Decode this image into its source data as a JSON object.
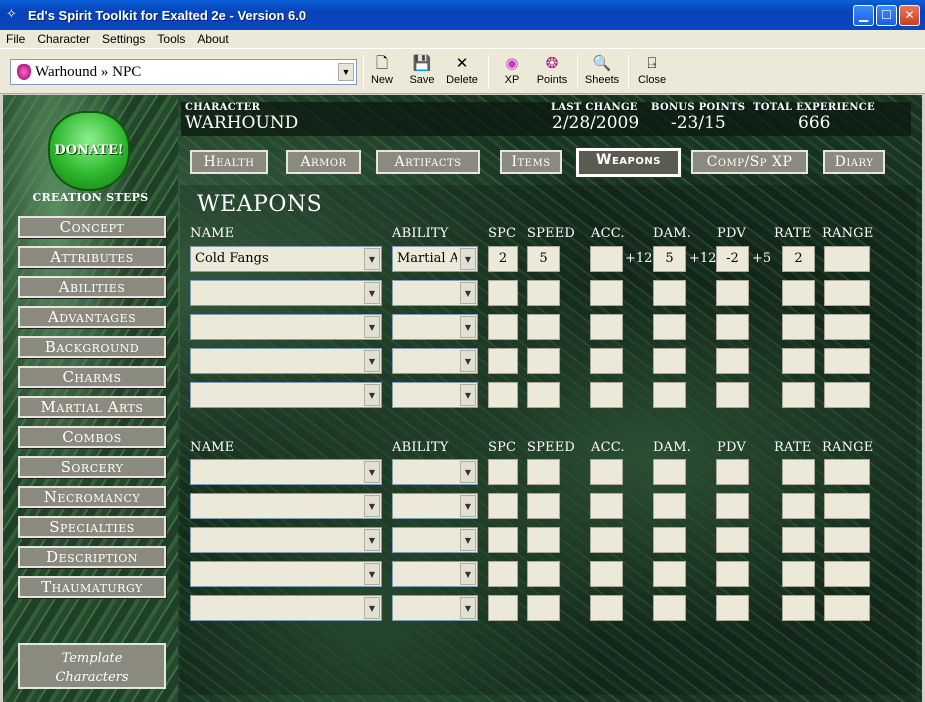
{
  "window": {
    "title": "Ed's Spirit Toolkit for Exalted 2e - Version 6.0"
  },
  "menu": [
    "File",
    "Character",
    "Settings",
    "Tools",
    "About"
  ],
  "toolbar": {
    "character_select": "Warhound » NPC",
    "buttons": [
      {
        "label": "New",
        "icon": "new-document-icon"
      },
      {
        "label": "Save",
        "icon": "floppy-disk-icon"
      },
      {
        "label": "Delete",
        "icon": "delete-x-icon"
      },
      {
        "label": "XP",
        "icon": "xp-icon"
      },
      {
        "label": "Points",
        "icon": "points-icon"
      },
      {
        "label": "Sheets",
        "icon": "sheets-icon"
      },
      {
        "label": "Close",
        "icon": "close-door-icon"
      }
    ]
  },
  "sidebar": {
    "donate": "DONATE!",
    "creation_steps": "CREATION STEPS",
    "items": [
      "Concept",
      "Attributes",
      "Abilities",
      "Advantages",
      "Background",
      "Charms",
      "Martial Arts",
      "Combos",
      "Sorcery",
      "Necromancy",
      "Specialties",
      "Description",
      "Thaumaturgy"
    ],
    "template_line1": "Template",
    "template_line2": "Characters"
  },
  "header": {
    "character_label": "CHARACTER",
    "character_value": "WARHOUND",
    "last_change_label": "LAST CHANGE",
    "last_change_value": "2/28/2009",
    "bonus_points_label": "BONUS POINTS",
    "bonus_points_value": "-23/15",
    "total_xp_label": "TOTAL EXPERIENCE",
    "total_xp_value": "666"
  },
  "tabs": [
    {
      "label": "Health",
      "active": false
    },
    {
      "label": "Armor",
      "active": false
    },
    {
      "label": "Artifacts",
      "active": false
    },
    {
      "label": "Items",
      "active": false
    },
    {
      "label": "Weapons",
      "active": true
    },
    {
      "label": "Comp/Sp XP",
      "active": false
    },
    {
      "label": "Diary",
      "active": false
    }
  ],
  "weapons": {
    "title": "WEAPONS",
    "columns": {
      "name": "NAME",
      "ability": "ABILITY",
      "spc": "SPC",
      "speed": "SPEED",
      "acc": "ACC.",
      "dam": "DAM.",
      "pdv": "PDV",
      "rate": "RATE",
      "range": "RANGE"
    },
    "group1_rows": [
      {
        "name": "Cold Fangs",
        "ability": "Martial Arts",
        "spc": "2",
        "speed": "5",
        "acc": "",
        "acc_mod": "+12",
        "dam": "5",
        "dam_mod": "+12",
        "pdv": "-2",
        "pdv_mod": "+5",
        "rate": "2",
        "range": ""
      },
      {
        "name": "",
        "ability": "",
        "spc": "",
        "speed": "",
        "acc": "",
        "acc_mod": "",
        "dam": "",
        "dam_mod": "",
        "pdv": "",
        "pdv_mod": "",
        "rate": "",
        "range": ""
      },
      {
        "name": "",
        "ability": "",
        "spc": "",
        "speed": "",
        "acc": "",
        "acc_mod": "",
        "dam": "",
        "dam_mod": "",
        "pdv": "",
        "pdv_mod": "",
        "rate": "",
        "range": ""
      },
      {
        "name": "",
        "ability": "",
        "spc": "",
        "speed": "",
        "acc": "",
        "acc_mod": "",
        "dam": "",
        "dam_mod": "",
        "pdv": "",
        "pdv_mod": "",
        "rate": "",
        "range": ""
      },
      {
        "name": "",
        "ability": "",
        "spc": "",
        "speed": "",
        "acc": "",
        "acc_mod": "",
        "dam": "",
        "dam_mod": "",
        "pdv": "",
        "pdv_mod": "",
        "rate": "",
        "range": ""
      }
    ],
    "group2_rows": [
      {
        "name": "",
        "ability": "",
        "spc": "",
        "speed": "",
        "acc": "",
        "acc_mod": "",
        "dam": "",
        "dam_mod": "",
        "pdv": "",
        "pdv_mod": "",
        "rate": "",
        "range": ""
      },
      {
        "name": "",
        "ability": "",
        "spc": "",
        "speed": "",
        "acc": "",
        "acc_mod": "",
        "dam": "",
        "dam_mod": "",
        "pdv": "",
        "pdv_mod": "",
        "rate": "",
        "range": ""
      },
      {
        "name": "",
        "ability": "",
        "spc": "",
        "speed": "",
        "acc": "",
        "acc_mod": "",
        "dam": "",
        "dam_mod": "",
        "pdv": "",
        "pdv_mod": "",
        "rate": "",
        "range": ""
      },
      {
        "name": "",
        "ability": "",
        "spc": "",
        "speed": "",
        "acc": "",
        "acc_mod": "",
        "dam": "",
        "dam_mod": "",
        "pdv": "",
        "pdv_mod": "",
        "rate": "",
        "range": ""
      },
      {
        "name": "",
        "ability": "",
        "spc": "",
        "speed": "",
        "acc": "",
        "acc_mod": "",
        "dam": "",
        "dam_mod": "",
        "pdv": "",
        "pdv_mod": "",
        "rate": "",
        "range": ""
      }
    ]
  }
}
